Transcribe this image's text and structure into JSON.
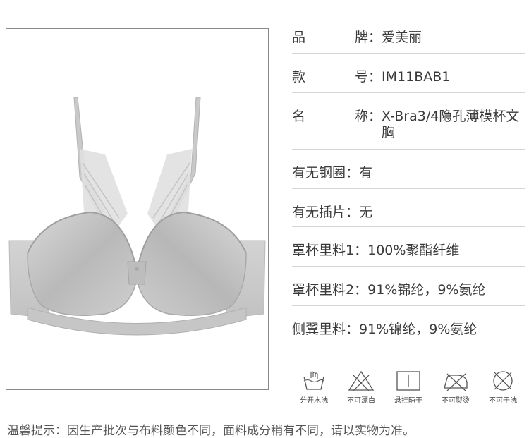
{
  "product_image": {
    "icon": "bra-photo",
    "color": "#c9c9c9"
  },
  "specs": [
    {
      "label_chars": [
        "品",
        "牌"
      ],
      "colon": "：",
      "value": "爱美丽"
    },
    {
      "label_chars": [
        "款",
        "号"
      ],
      "colon": "：",
      "value": "IM11BAB1"
    },
    {
      "label_chars": [
        "名",
        "称"
      ],
      "colon": "：",
      "value": "X-Bra3/4隐孔薄模杯文胸"
    },
    {
      "label": "有无钢圈",
      "colon": "：",
      "value": "有"
    },
    {
      "label": "有无插片",
      "colon": "：",
      "value": "无"
    },
    {
      "label": "罩杯里料1",
      "colon": "：",
      "value": "100%聚酯纤维"
    },
    {
      "label": "罩杯里料2",
      "colon": "：",
      "value": "91%锦纶，9%氨纶"
    },
    {
      "label": "侧翼里料",
      "colon": "：",
      "value": "91%锦纶，9%氨纶"
    }
  ],
  "care": [
    {
      "icon": "hand-wash-icon",
      "label": "分开水洗"
    },
    {
      "icon": "no-bleach-icon",
      "label": "不可漂白"
    },
    {
      "icon": "line-dry-icon",
      "label": "悬挂晾干"
    },
    {
      "icon": "no-iron-icon",
      "label": "不可熨烫"
    },
    {
      "icon": "no-dry-clean-icon",
      "label": "不可干洗"
    }
  ],
  "footer": {
    "note": "温馨提示：因生产批次与布料颜色不同，面料成分稍有不同，请以实物为准。"
  },
  "colors": {
    "text": "#3a3a3a",
    "divider": "#d6d6d6",
    "frame_border": "#8a8a8a"
  }
}
